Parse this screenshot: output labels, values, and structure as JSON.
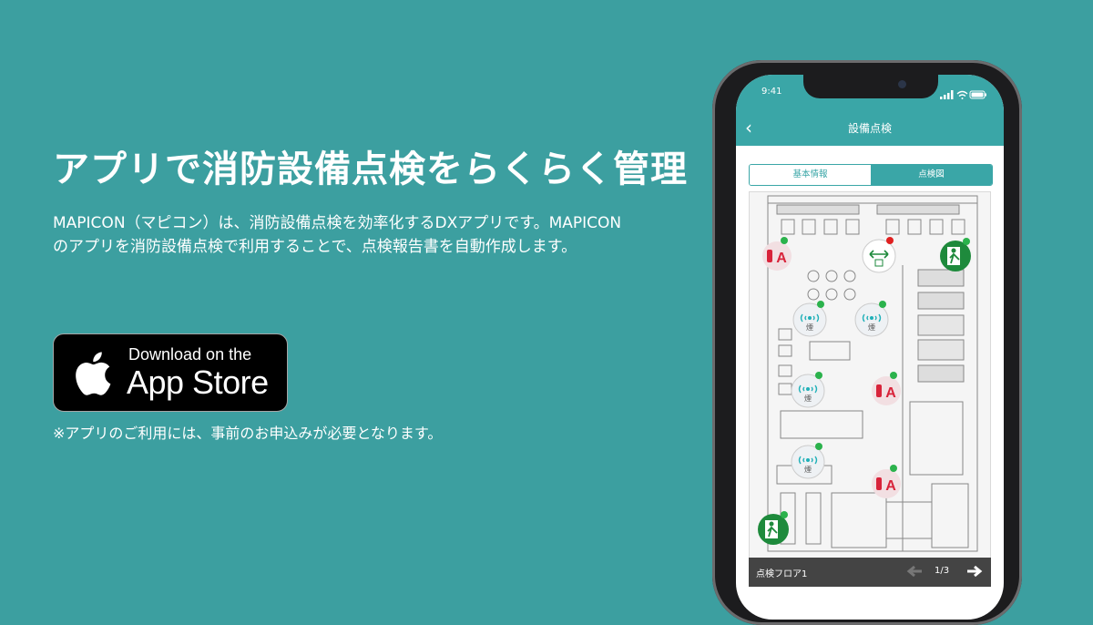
{
  "headline": "アプリで消防設備点検をらくらく管理",
  "description": {
    "line1": "MAPICON（マピコン）は、消防設備点検を効率化するDXアプリです。MAPICON",
    "line2": "のアプリを消防設備点検で利用することで、点検報告書を自動作成します。"
  },
  "app_store": {
    "line1": "Download on the",
    "line2": "App Store"
  },
  "note": "※アプリのご利用には、事前のお申込みが必要となります。",
  "phone": {
    "status_time": "9:41",
    "nav_title": "設備点検",
    "tabs": [
      {
        "label": "基本情報",
        "active": false
      },
      {
        "label": "点検図",
        "active": true
      }
    ],
    "map_markers": {
      "smoke_char": "煙",
      "extinguisher_char": "A",
      "exit_char": "EXIT"
    },
    "floor_name": "点検フロア1",
    "page": "1/3"
  },
  "colors": {
    "background": "#3c9fa0",
    "app_header": "#3aa6a7",
    "ok_dot": "#2bb24c",
    "alert_dot": "#e02020",
    "extinguisher": "#d8233a",
    "exit_sign": "#1e8a3c"
  },
  "icons": [
    "apple-icon",
    "back-chevron-icon",
    "signal-icon",
    "wifi-icon",
    "battery-icon",
    "smoke-detector-icon",
    "fire-extinguisher-icon",
    "emergency-exit-icon",
    "exit-light-icon",
    "arrow-left-icon",
    "arrow-right-icon"
  ]
}
